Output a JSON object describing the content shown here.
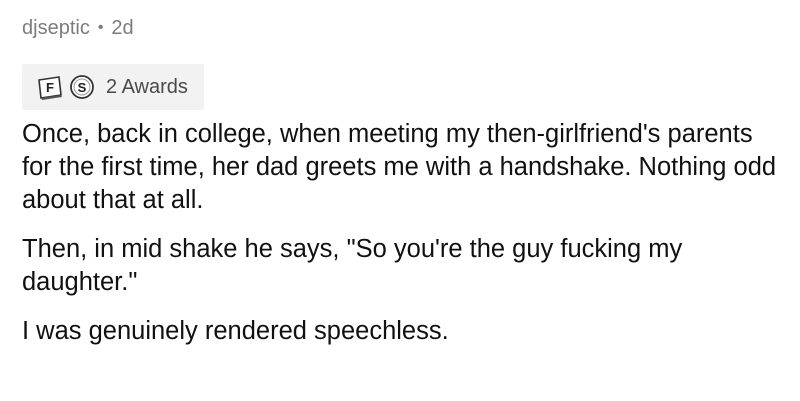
{
  "comment": {
    "author": "djseptic",
    "separator": "•",
    "age": "2d",
    "awards": {
      "icons": [
        "f-award-icon",
        "s-award-icon"
      ],
      "icon_letters": [
        "F",
        "S"
      ],
      "count_label": "2 Awards"
    },
    "paragraphs": [
      "Once, back in college, when meeting my then-girlfriend's parents for the first time, her dad greets me with a handshake.  Nothing odd about that at all.",
      "Then, in mid shake he says, \"So you're the guy fucking my daughter.\"",
      "I was genuinely rendered speechless."
    ]
  }
}
